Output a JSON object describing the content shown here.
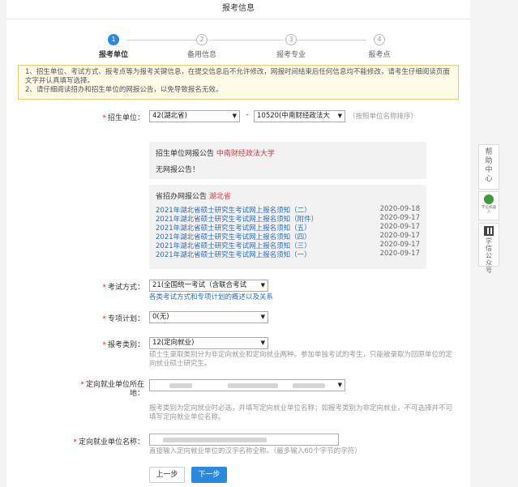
{
  "page": {
    "title": "报考信息"
  },
  "steps": [
    {
      "num": "1",
      "label": "报考单位",
      "active": true
    },
    {
      "num": "2",
      "label": "备用信息",
      "active": false
    },
    {
      "num": "3",
      "label": "报考专业",
      "active": false
    },
    {
      "num": "4",
      "label": "报考点",
      "active": false
    }
  ],
  "notice": {
    "line1": "1、招生单位、考试方式、报考点等为报考关键信息，在提交信息后不允许修改，网报时间结束后任何信息均不能修改，请考生仔细阅读页面文字并认真填写选择。",
    "line2": "2、请仔细阅读招办和招生单位的网报公告，以免导致报名无效。"
  },
  "form": {
    "unit": {
      "label": "招生单位：",
      "province_value": "42(湖北省)",
      "dash": "-",
      "unit_value": "10520(中南财经政法大",
      "hint": "（按照单位名称排序）"
    },
    "unit_notice": {
      "head_prefix": "招生单位网报公告",
      "head_unit": "中南财经政法大学",
      "body": "无网报公告！"
    },
    "province_notice": {
      "head_prefix": "省招办网报公告",
      "head_province": "湖北省",
      "items": [
        {
          "title": "2021年湖北省硕士研究生考试网上报名须知（二）",
          "date": "2020-09-18"
        },
        {
          "title": "2021年湖北省硕士研究生考试网上报名须知（附件）",
          "date": "2020-09-17"
        },
        {
          "title": "2021年湖北省硕士研究生考试网上报名须知（五）",
          "date": "2020-09-17"
        },
        {
          "title": "2021年湖北省硕士研究生考试网上报名须知（四）",
          "date": "2020-09-17"
        },
        {
          "title": "2021年湖北省硕士研究生考试网上报名须知（三）",
          "date": "2020-09-17"
        },
        {
          "title": "2021年湖北省硕士研究生考试网上报名须知（一）",
          "date": "2020-09-17"
        }
      ]
    },
    "exam_mode": {
      "label": "考试方式：",
      "value": "21(全国统一考试（含联合考试",
      "link": "各类考试方式和专项计划的概述以及关系"
    },
    "special_plan": {
      "label": "专项计划：",
      "value": "0(无)"
    },
    "category": {
      "label": "报考类别：",
      "value": "12(定向就业)",
      "hint": "硕士生录取类别分为非定向就业和定向就业两种。参加单独考试的考生，只能被录取为回原单位的定向就业硕士研究生。"
    },
    "directed_location": {
      "label_line1": "定向就业单位所在",
      "label_line2": "地：",
      "hint": "报考类别为定向就业时必选，并填写定向就业单位名称；如报考类别为非定向就业，不可选择并不可填写定向就业单位名称。"
    },
    "directed_name": {
      "label": "定向就业单位名称：",
      "hint": "直接输入定向就业单位的汉字名称全称。（最多输入60个字节的字符）"
    }
  },
  "buttons": {
    "prev": "上一步",
    "next": "下一步"
  },
  "sidebar": {
    "help": "帮助中心",
    "robot": "学信机器人",
    "qr": "学信公众号"
  },
  "colors": {
    "accent": "#2a8ae0",
    "required": "#e02020",
    "link": "#2a6ebd",
    "notice_border": "#f0c76e"
  }
}
